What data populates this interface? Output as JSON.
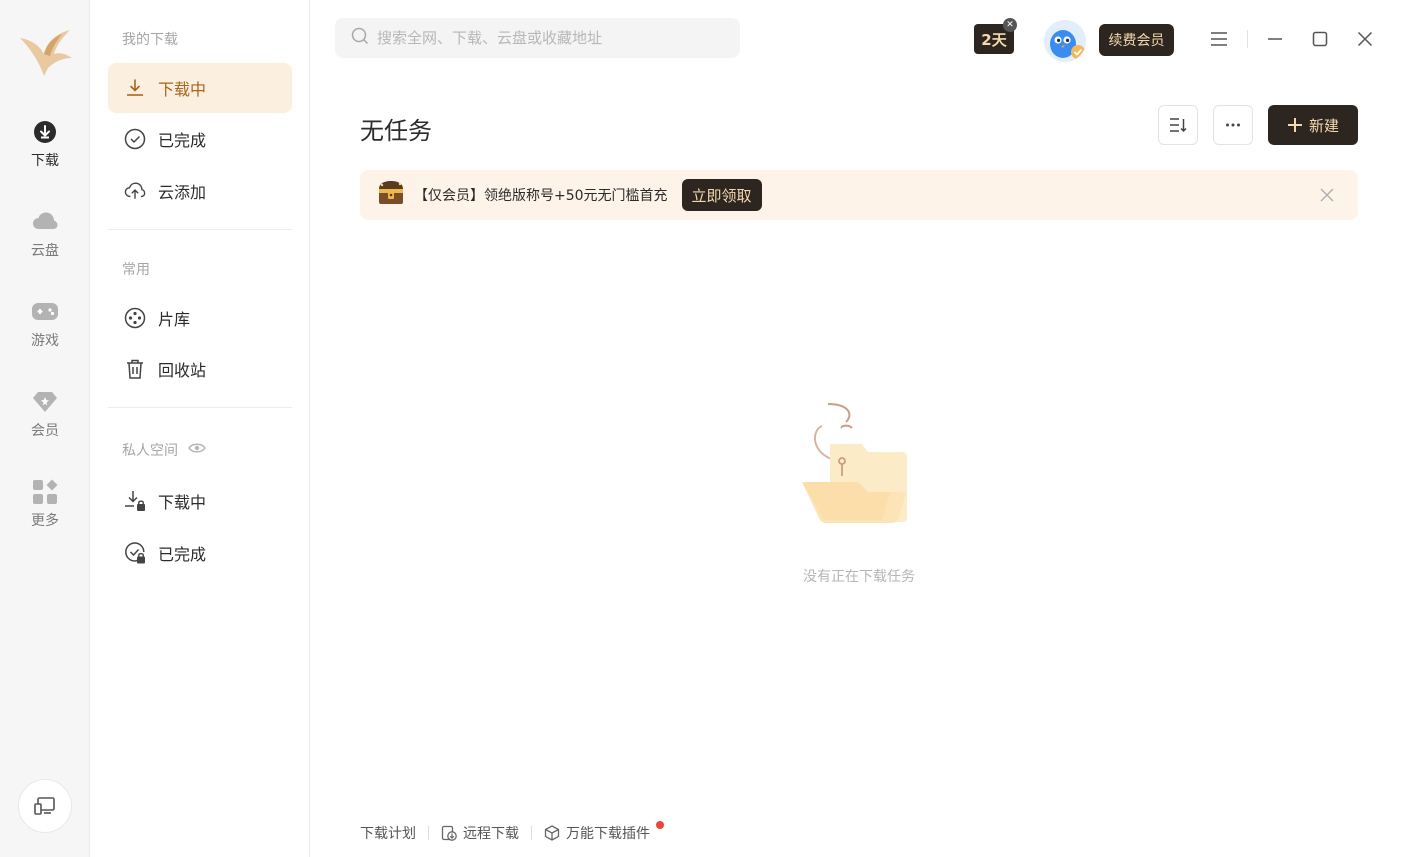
{
  "rail": {
    "items": [
      {
        "label": "下载"
      },
      {
        "label": "云盘"
      },
      {
        "label": "游戏"
      },
      {
        "label": "会员"
      },
      {
        "label": "更多"
      }
    ]
  },
  "sidebar": {
    "my_downloads_title": "我的下载",
    "items": [
      {
        "label": "下载中"
      },
      {
        "label": "已完成"
      },
      {
        "label": "云添加"
      }
    ],
    "common_title": "常用",
    "common_items": [
      {
        "label": "片库"
      },
      {
        "label": "回收站"
      }
    ],
    "private_title": "私人空间",
    "private_items": [
      {
        "label": "下载中"
      },
      {
        "label": "已完成"
      }
    ]
  },
  "header": {
    "search_placeholder": "搜索全网、下载、云盘或收藏地址",
    "days_badge": "2天",
    "renew_label": "续费会员"
  },
  "main": {
    "title": "无任务",
    "new_label": "新建",
    "promo_text": "【仅会员】领绝版称号+50元无门槛首充",
    "promo_button": "立即领取",
    "empty_text": "没有正在下载任务"
  },
  "footer": {
    "links": [
      {
        "label": "下载计划"
      },
      {
        "label": "远程下载"
      },
      {
        "label": "万能下载插件"
      }
    ]
  },
  "colors": {
    "accent": "#a9661c",
    "dark_button": "#2c2520",
    "gold_text": "#f4d9ae",
    "active_bg": "#fbefdf",
    "notification": "#f0443a"
  }
}
